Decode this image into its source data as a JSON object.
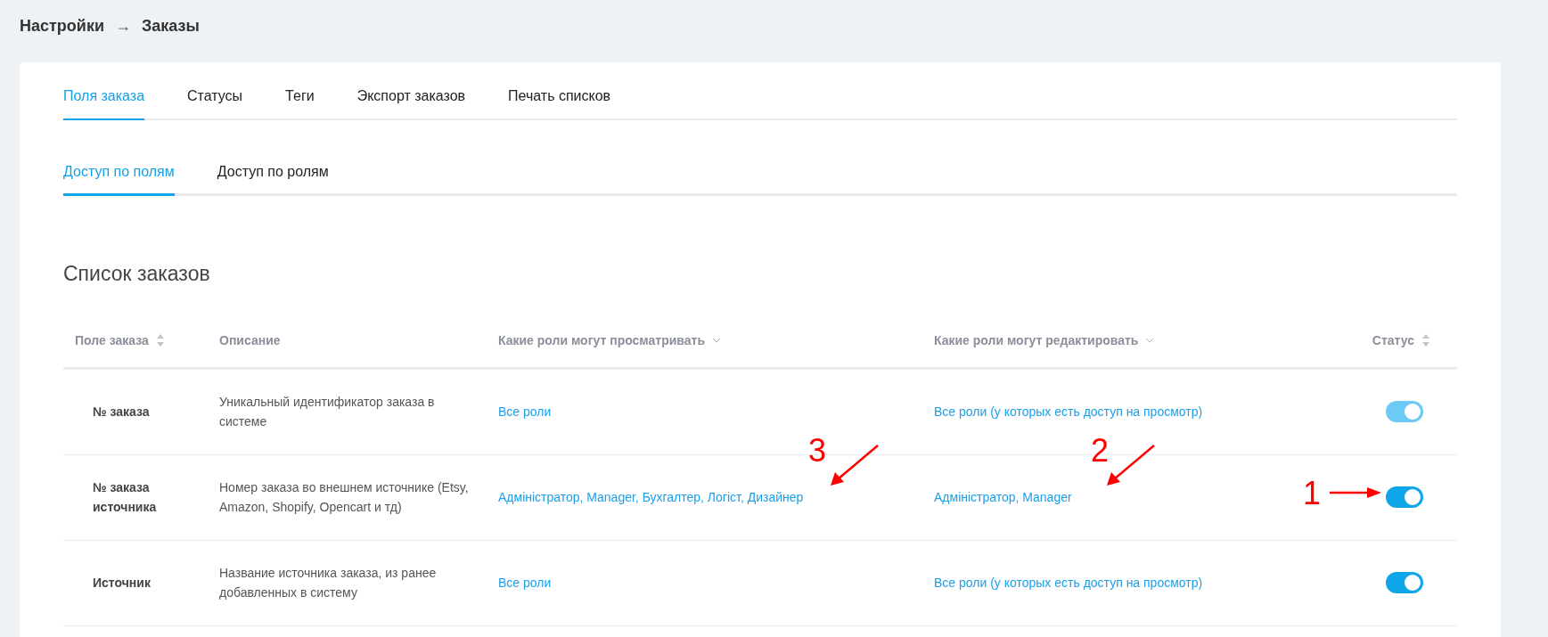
{
  "breadcrumb": {
    "parent": "Настройки",
    "separator": "→",
    "current": "Заказы"
  },
  "tabs": [
    {
      "label": "Поля заказа",
      "selected": true
    },
    {
      "label": "Статусы",
      "selected": false
    },
    {
      "label": "Теги",
      "selected": false
    },
    {
      "label": "Экспорт заказов",
      "selected": false
    },
    {
      "label": "Печать списков",
      "selected": false
    }
  ],
  "subtabs": [
    {
      "label": "Доступ по полям",
      "selected": true
    },
    {
      "label": "Доступ по ролям",
      "selected": false
    }
  ],
  "section_title": "Список заказов",
  "table": {
    "columns": [
      {
        "label": "Поле заказа",
        "kind": "sort"
      },
      {
        "label": "Описание",
        "kind": "plain"
      },
      {
        "label": "Какие роли могут просматривать",
        "kind": "dropdown"
      },
      {
        "label": "Какие роли могут редактировать",
        "kind": "dropdown"
      },
      {
        "label": "Статус",
        "kind": "sort"
      }
    ],
    "rows": [
      {
        "field": "№ заказа",
        "description": "Уникальный идентификатор заказа в системе",
        "view_roles": "Все роли",
        "edit_roles": "Все роли (у которых есть доступ на просмотр)",
        "on": true,
        "disabled": true
      },
      {
        "field": "№ заказа источника",
        "description": "Номер заказа во внешнем источнике (Etsy, Amazon, Shopify, Opencart и тд)",
        "view_roles": "Адміністратор, Manager, Бухгалтер, Логіст, Дизайнер",
        "edit_roles": "Адміністратор, Manager",
        "on": true,
        "disabled": false
      },
      {
        "field": "Источник",
        "description": "Название источника заказа, из ранее добавленных в систему",
        "view_roles": "Все роли",
        "edit_roles": "Все роли (у которых есть доступ на просмотр)",
        "on": true,
        "disabled": false
      }
    ]
  },
  "annotations": [
    {
      "label": "3",
      "kind": "diagonal"
    },
    {
      "label": "2",
      "kind": "diagonal"
    },
    {
      "label": "1",
      "kind": "horizontal"
    }
  ]
}
